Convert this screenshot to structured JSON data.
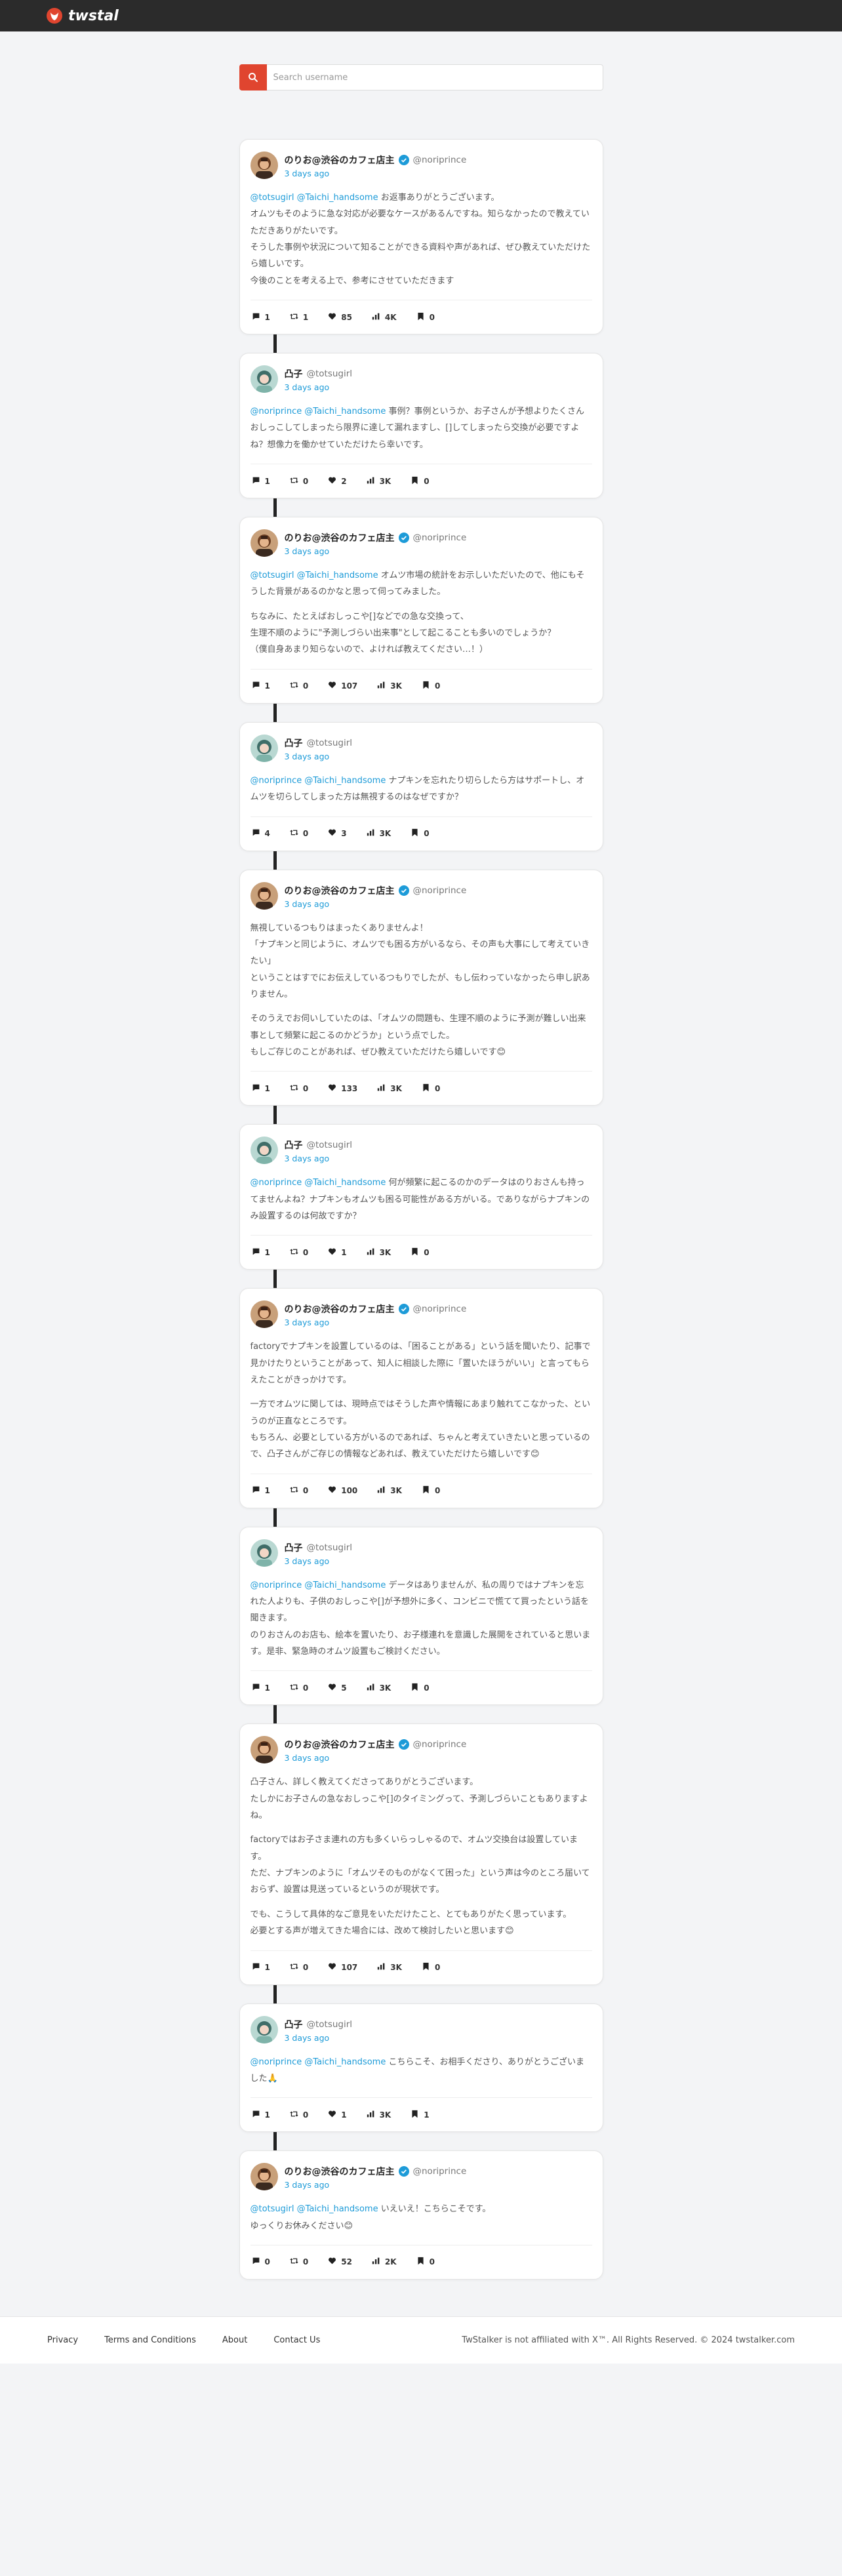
{
  "app": {
    "name": "twstal",
    "logo_icon": "twstalker-logo-icon",
    "accent": "#e0452f"
  },
  "search": {
    "placeholder": "Search username",
    "icon": "search-icon"
  },
  "colors": {
    "mention": "#1d9bd8",
    "verified": "#1d9bd8",
    "topbar": "#2b2b2b"
  },
  "tweets": [
    {
      "author": "norio",
      "display_name": "のりお@渋谷のカフェ店主",
      "handle": "@noriprince",
      "verified": true,
      "time": "3 days ago",
      "mentions": "@totsugirl @Taichi_handsome",
      "paragraphs": [
        "お返事ありがとうございます。",
        "オムツもそのように急な対応が必要なケースがあるんですね。知らなかったので教えていただきありがたいです。",
        "そうした事例や状況について知ることができる資料や声があれば、ぜひ教えていただけたら嬉しいです。",
        "今後のことを考える上で、参考にさせていただきます"
      ],
      "stats": {
        "replies": "1",
        "retweets": "1",
        "likes": "85",
        "views": "4K",
        "bookmarks": "0"
      }
    },
    {
      "author": "totsugirl",
      "display_name": "凸子",
      "handle": "@totsugirl",
      "verified": false,
      "time": "3 days ago",
      "mentions": "@noriprince @Taichi_handsome",
      "paragraphs": [
        "事例？事例というか、お子さんが予想よりたくさんおしっこしてしまったら限界に達して漏れますし、[]してしまったら交換が必要ですよね？想像力を働かせていただけたら幸いです。"
      ],
      "stats": {
        "replies": "1",
        "retweets": "0",
        "likes": "2",
        "views": "3K",
        "bookmarks": "0"
      }
    },
    {
      "author": "norio",
      "display_name": "のりお@渋谷のカフェ店主",
      "handle": "@noriprince",
      "verified": true,
      "time": "3 days ago",
      "mentions": "@totsugirl @Taichi_handsome",
      "paragraphs": [
        "オムツ市場の統計をお示しいただいたので、他にもそうした背景があるのかなと思って伺ってみました。",
        "",
        "ちなみに、たとえばおしっこや[]などでの急な交換って、",
        "生理不順のように\"予測しづらい出来事\"として起こることも多いのでしょうか？",
        "（僕自身あまり知らないので、よければ教えてください…！）"
      ],
      "stats": {
        "replies": "1",
        "retweets": "0",
        "likes": "107",
        "views": "3K",
        "bookmarks": "0"
      }
    },
    {
      "author": "totsugirl",
      "display_name": "凸子",
      "handle": "@totsugirl",
      "verified": false,
      "time": "3 days ago",
      "mentions": "@noriprince @Taichi_handsome",
      "paragraphs": [
        "ナプキンを忘れたり切らしたら方はサポートし、オムツを切らしてしまった方は無視するのはなぜですか？"
      ],
      "stats": {
        "replies": "4",
        "retweets": "0",
        "likes": "3",
        "views": "3K",
        "bookmarks": "0"
      }
    },
    {
      "author": "norio",
      "display_name": "のりお@渋谷のカフェ店主",
      "handle": "@noriprince",
      "verified": true,
      "time": "3 days ago",
      "mentions": "",
      "paragraphs": [
        "無視しているつもりはまったくありませんよ！",
        "「ナプキンと同じように、オムツでも困る方がいるなら、その声も大事にして考えていきたい」",
        "ということはすでにお伝えしているつもりでしたが、もし伝わっていなかったら申し訳ありません。",
        "",
        "そのうえでお伺いしていたのは、「オムツの問題も、生理不順のように予測が難しい出来事として頻繁に起こるのかどうか」という点でした。",
        "もしご存じのことがあれば、ぜひ教えていただけたら嬉しいです😊"
      ],
      "stats": {
        "replies": "1",
        "retweets": "0",
        "likes": "133",
        "views": "3K",
        "bookmarks": "0"
      }
    },
    {
      "author": "totsugirl",
      "display_name": "凸子",
      "handle": "@totsugirl",
      "verified": false,
      "time": "3 days ago",
      "mentions": "@noriprince @Taichi_handsome",
      "paragraphs": [
        "何が頻繁に起こるのかのデータはのりおさんも持ってませんよね？ナプキンもオムツも困る可能性がある方がいる。でありながらナプキンのみ設置するのは何故ですか？"
      ],
      "stats": {
        "replies": "1",
        "retweets": "0",
        "likes": "1",
        "views": "3K",
        "bookmarks": "0"
      }
    },
    {
      "author": "norio",
      "display_name": "のりお@渋谷のカフェ店主",
      "handle": "@noriprince",
      "verified": true,
      "time": "3 days ago",
      "mentions": "",
      "paragraphs": [
        "factoryでナプキンを設置しているのは、「困ることがある」という話を聞いたり、記事で見かけたりということがあって、知人に相談した際に「置いたほうがいい」と言ってもらえたことがきっかけです。",
        "",
        "一方でオムツに関しては、現時点ではそうした声や情報にあまり触れてこなかった、というのが正直なところです。",
        "もちろん、必要としている方がいるのであれば、ちゃんと考えていきたいと思っているので、凸子さんがご存じの情報などあれば、教えていただけたら嬉しいです😊"
      ],
      "stats": {
        "replies": "1",
        "retweets": "0",
        "likes": "100",
        "views": "3K",
        "bookmarks": "0"
      }
    },
    {
      "author": "totsugirl",
      "display_name": "凸子",
      "handle": "@totsugirl",
      "verified": false,
      "time": "3 days ago",
      "mentions": "@noriprince @Taichi_handsome",
      "paragraphs": [
        "データはありませんが、私の周りではナプキンを忘れた人よりも、子供のおしっこや[]が予想外に多く、コンビニで慌てて買ったという話を聞きます。",
        "のりおさんのお店も、絵本を置いたり、お子様連れを意識した展開をされていると思います。是非、緊急時のオムツ設置もご検討ください。"
      ],
      "stats": {
        "replies": "1",
        "retweets": "0",
        "likes": "5",
        "views": "3K",
        "bookmarks": "0"
      }
    },
    {
      "author": "norio",
      "display_name": "のりお@渋谷のカフェ店主",
      "handle": "@noriprince",
      "verified": true,
      "time": "3 days ago",
      "mentions": "",
      "paragraphs": [
        "凸子さん、詳しく教えてくださってありがとうございます。",
        "たしかにお子さんの急なおしっこや[]のタイミングって、予測しづらいこともありますよね。",
        "",
        "factoryではお子さま連れの方も多くいらっしゃるので、オムツ交換台は設置しています。",
        "ただ、ナプキンのように「オムツそのものがなくて困った」という声は今のところ届いておらず、設置は見送っているというのが現状です。",
        "",
        "でも、こうして具体的なご意見をいただけたこと、とてもありがたく思っています。",
        "必要とする声が増えてきた場合には、改めて検討したいと思います😊"
      ],
      "stats": {
        "replies": "1",
        "retweets": "0",
        "likes": "107",
        "views": "3K",
        "bookmarks": "0"
      }
    },
    {
      "author": "totsugirl",
      "display_name": "凸子",
      "handle": "@totsugirl",
      "verified": false,
      "time": "3 days ago",
      "mentions": "@noriprince @Taichi_handsome",
      "paragraphs": [
        "こちらこそ、お相手くださり、ありがとうございました🙏"
      ],
      "stats": {
        "replies": "1",
        "retweets": "0",
        "likes": "1",
        "views": "3K",
        "bookmarks": "1"
      }
    },
    {
      "author": "norio",
      "display_name": "のりお@渋谷のカフェ店主",
      "handle": "@noriprince",
      "verified": true,
      "time": "3 days ago",
      "mentions": "@totsugirl @Taichi_handsome",
      "paragraphs": [
        "いえいえ！こちらこそです。",
        "ゆっくりお休みください😊"
      ],
      "stats": {
        "replies": "0",
        "retweets": "0",
        "likes": "52",
        "views": "2K",
        "bookmarks": "0"
      }
    }
  ],
  "footer": {
    "links": [
      "Privacy",
      "Terms and Conditions",
      "About",
      "Contact Us"
    ],
    "copyright": "TwStalker is not affiliated with X™. All Rights Reserved. © 2024 twstalker.com"
  }
}
